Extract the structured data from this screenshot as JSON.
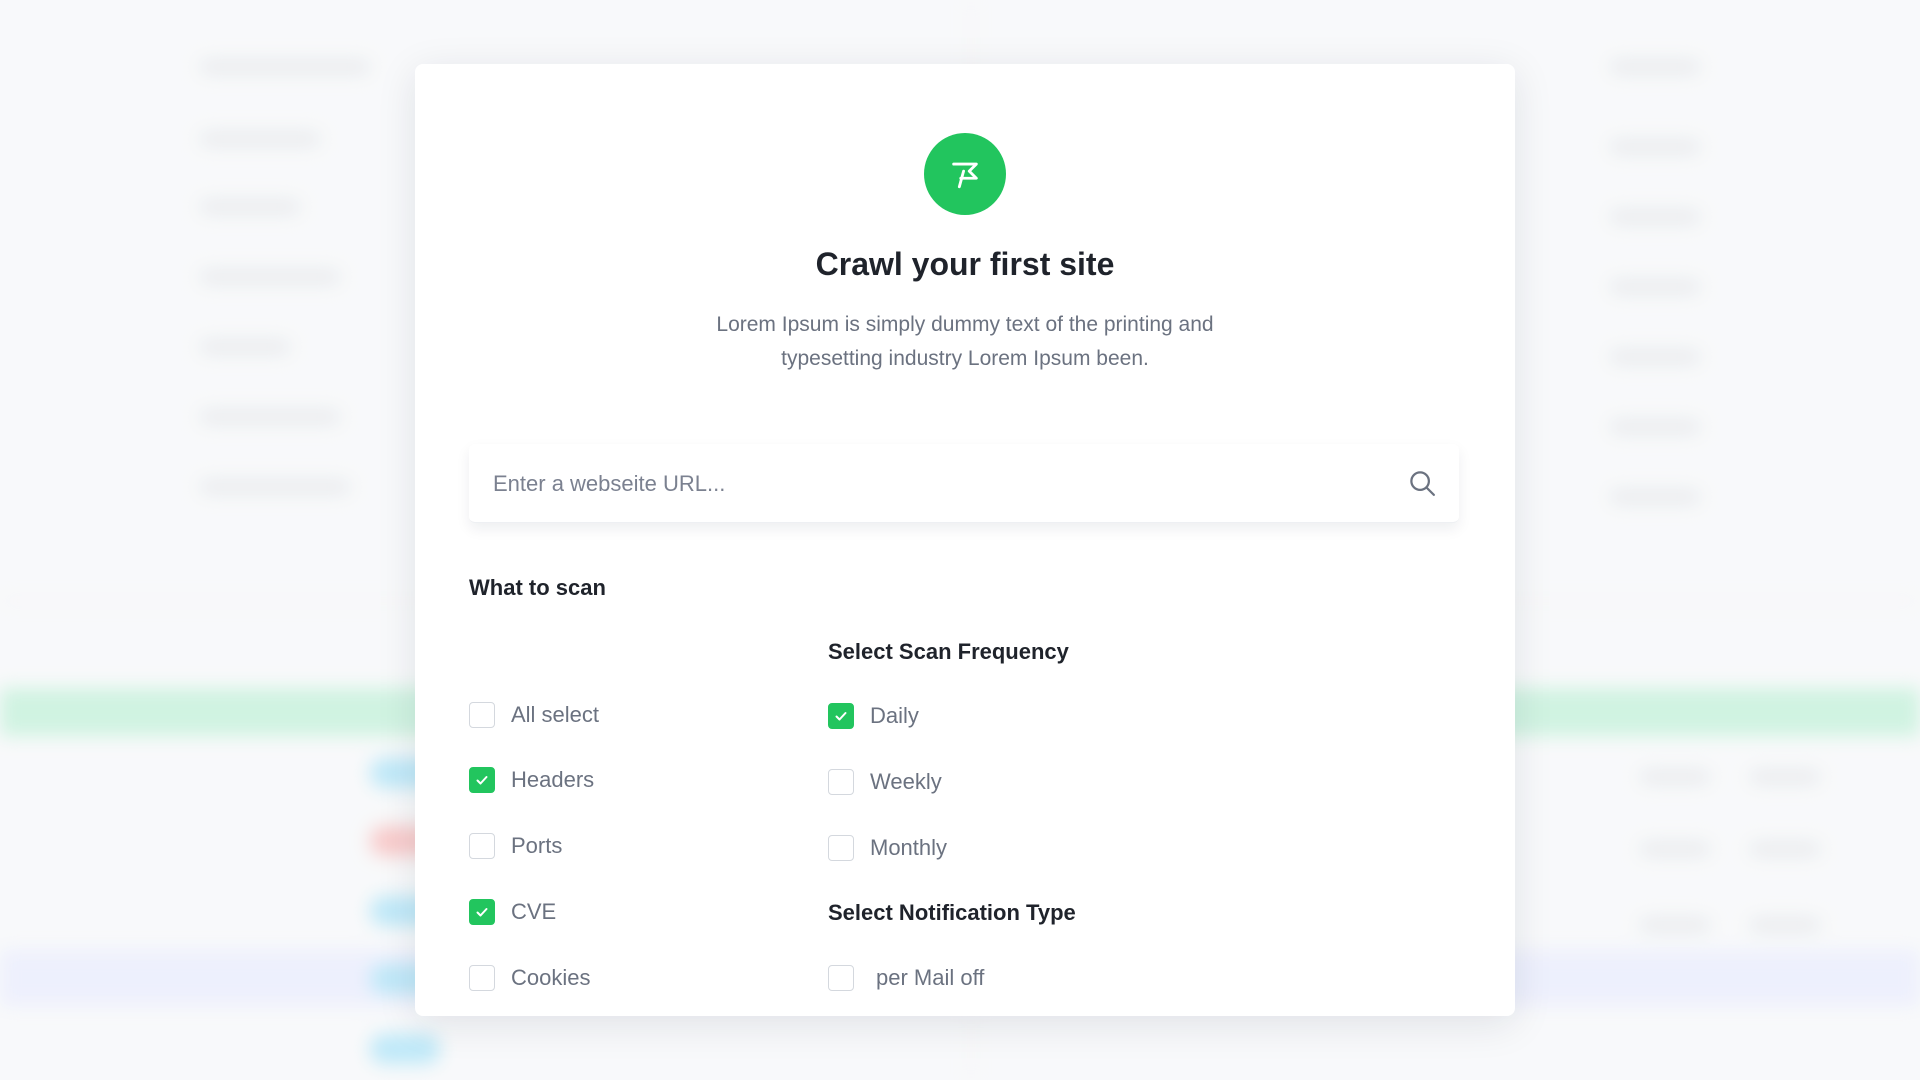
{
  "modal": {
    "title": "Crawl your first site",
    "subtitle": "Lorem Ipsum is simply dummy text of the printing and typesetting industry Lorem Ipsum been.",
    "logo_icon": "flag-icon",
    "accent_color": "#22c55e"
  },
  "search": {
    "placeholder": "Enter a webseite URL...",
    "value": "",
    "icon": "search-icon"
  },
  "what_to_scan": {
    "heading": "What to scan",
    "options": [
      {
        "label": "All select",
        "checked": false
      },
      {
        "label": "Headers",
        "checked": true
      },
      {
        "label": "Ports",
        "checked": false
      },
      {
        "label": "CVE",
        "checked": true
      },
      {
        "label": "Cookies",
        "checked": false
      }
    ]
  },
  "scan_frequency": {
    "heading": "Select Scan Frequency",
    "options": [
      {
        "label": "Daily",
        "checked": true
      },
      {
        "label": "Weekly",
        "checked": false
      },
      {
        "label": "Monthly",
        "checked": false
      }
    ]
  },
  "notification_type": {
    "heading": "Select Notification Type",
    "options": [
      {
        "label": "per Mail off",
        "checked": false
      }
    ]
  }
}
